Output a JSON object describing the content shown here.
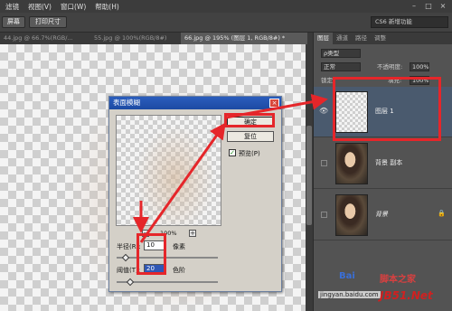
{
  "menu": {
    "items": [
      "滤镜",
      "视图(V)",
      "窗口(W)",
      "帮助(H)"
    ]
  },
  "window": {
    "min": "–",
    "max": "□",
    "close": "×"
  },
  "options": {
    "screen_btn": "屏幕",
    "print_btn": "打印尺寸",
    "workspace": "CS6 新增功能"
  },
  "tabs": [
    {
      "label": "44.jpg @ 66.7%(RGB/..."
    },
    {
      "label": "55.jpg @ 100%(RGB/8#)"
    },
    {
      "label": "66.jpg @ 195% (图层 1, RGB/8#) *"
    }
  ],
  "panel": {
    "tabs": [
      "图层",
      "通道",
      "路径",
      "调整"
    ],
    "kind_label": "ρ类型",
    "blend_mode": "正常",
    "opacity_label": "不透明度:",
    "opacity_value": "100%",
    "lock_label": "锁定:",
    "fill_label": "填充:",
    "fill_value": "100%",
    "layers": [
      {
        "name": "图层 1",
        "visible": true,
        "selected": true
      },
      {
        "name": "背景 副本",
        "visible": false,
        "selected": false
      },
      {
        "name": "背景",
        "visible": false,
        "selected": false,
        "locked": true
      }
    ],
    "lock_icon": "🔒"
  },
  "dialog": {
    "title": "表面模糊",
    "close": "×",
    "ok": "确定",
    "reset": "复位",
    "preview_checked": "✓",
    "preview_label": "预览(P)",
    "zoom_minus": "−",
    "zoom_plus": "+",
    "zoom_value": "100%",
    "radius_label": "半径(R):",
    "radius_value": "10",
    "radius_unit": "像素",
    "threshold_label": "阈值(T):",
    "threshold_value": "20",
    "threshold_unit": "色阶"
  },
  "watermark": {
    "baidu": "Bai",
    "baidu2": "脚本之家",
    "url": "jingyan.baidu.com",
    "jb51": "JB51.Net"
  },
  "colors": {
    "highlight": "#e5262a",
    "title_bar": "#2b5dbd",
    "selected_layer": "#4a5a6e"
  }
}
